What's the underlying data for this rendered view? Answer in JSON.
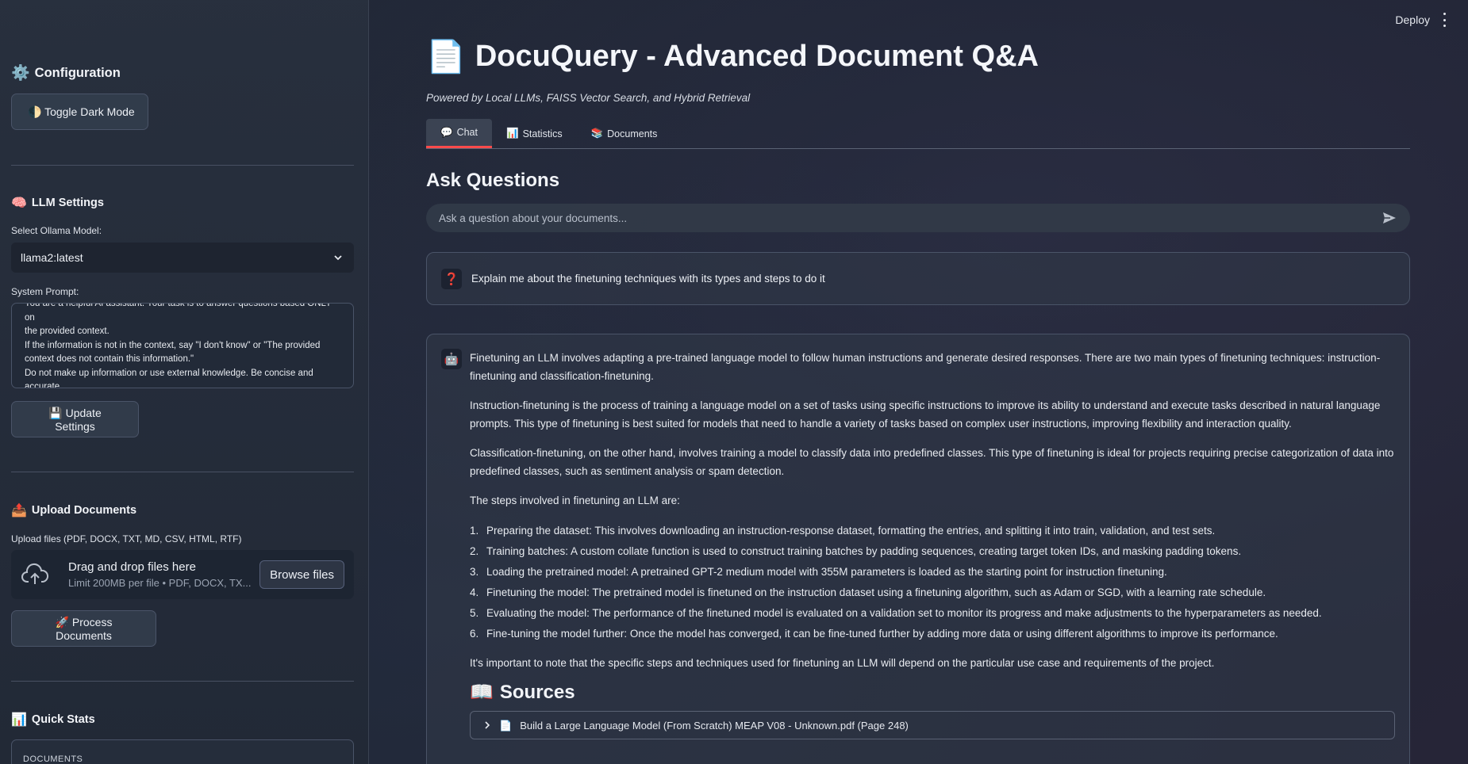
{
  "topbar": {
    "deploy_label": "Deploy"
  },
  "sidebar": {
    "configuration": {
      "icon": "⚙️",
      "title": "Configuration",
      "toggle_label": "🌓 Toggle Dark Mode"
    },
    "llm": {
      "icon": "🧠",
      "title": "LLM Settings",
      "model_label": "Select Ollama Model:",
      "model_value": "llama2:latest",
      "prompt_label": "System Prompt:",
      "prompt_lines": [
        "You are a helpful AI assistant. Your task is to answer questions based ONLY on",
        "the provided context.",
        "If the information is not in the context, say \"I don't know\" or \"The provided",
        "context does not contain this information.\"",
        "Do not make up information or use external knowledge. Be concise and",
        "accurate."
      ],
      "update_label": "💾 Update Settings"
    },
    "upload": {
      "icon": "📤",
      "title": "Upload Documents",
      "files_label": "Upload files (PDF, DOCX, TXT, MD, CSV, HTML, RTF)",
      "drop_title": "Drag and drop files here",
      "drop_limit": "Limit 200MB per file • PDF, DOCX, TX...",
      "browse_label": "Browse files",
      "process_label": "🚀 Process Documents"
    },
    "stats": {
      "icon": "📊",
      "title": "Quick Stats",
      "documents_label": "DOCUMENTS"
    }
  },
  "main": {
    "title_icon": "📄",
    "title": "DocuQuery - Advanced Document Q&A",
    "subtitle": "Powered by Local LLMs, FAISS Vector Search, and Hybrid Retrieval",
    "tabs": [
      {
        "icon": "💬",
        "label": "Chat"
      },
      {
        "icon": "📊",
        "label": "Statistics"
      },
      {
        "icon": "📚",
        "label": "Documents"
      }
    ],
    "section_title": "Ask Questions",
    "chat_placeholder": "Ask a question about your documents...",
    "user_icon": "❓",
    "user_message": "Explain me about the finetuning techniques with its types and steps to do it",
    "bot_icon": "🤖",
    "bot_paragraphs": [
      "Finetuning an LLM involves adapting a pre-trained language model to follow human instructions and generate desired responses. There are two main types of finetuning techniques: instruction-finetuning and classification-finetuning.",
      "Instruction-finetuning is the process of training a language model on a set of tasks using specific instructions to improve its ability to understand and execute tasks described in natural language prompts. This type of finetuning is best suited for models that need to handle a variety of tasks based on complex user instructions, improving flexibility and interaction quality.",
      "Classification-finetuning, on the other hand, involves training a model to classify data into predefined classes. This type of finetuning is ideal for projects requiring precise categorization of data into predefined classes, such as sentiment analysis or spam detection.",
      "The steps involved in finetuning an LLM are:"
    ],
    "steps": [
      "Preparing the dataset: This involves downloading an instruction-response dataset, formatting the entries, and splitting it into train, validation, and test sets.",
      "Training batches: A custom collate function is used to construct training batches by padding sequences, creating target token IDs, and masking padding tokens.",
      "Loading the pretrained model: A pretrained GPT-2 medium model with 355M parameters is loaded as the starting point for instruction finetuning.",
      "Finetuning the model: The pretrained model is finetuned on the instruction dataset using a finetuning algorithm, such as Adam or SGD, with a learning rate schedule.",
      "Evaluating the model: The performance of the finetuned model is evaluated on a validation set to monitor its progress and make adjustments to the hyperparameters as needed.",
      "Fine-tuning the model further: Once the model has converged, it can be fine-tuned further by adding more data or using different algorithms to improve its performance."
    ],
    "closing": "It's important to note that the specific steps and techniques used for finetuning an LLM will depend on the particular use case and requirements of the project.",
    "sources_icon": "📖",
    "sources_title": "Sources",
    "source_icon": "📄",
    "source_item": "Build a Large Language Model (From Scratch) MEAP V08 - Unknown.pdf (Page 248)"
  }
}
